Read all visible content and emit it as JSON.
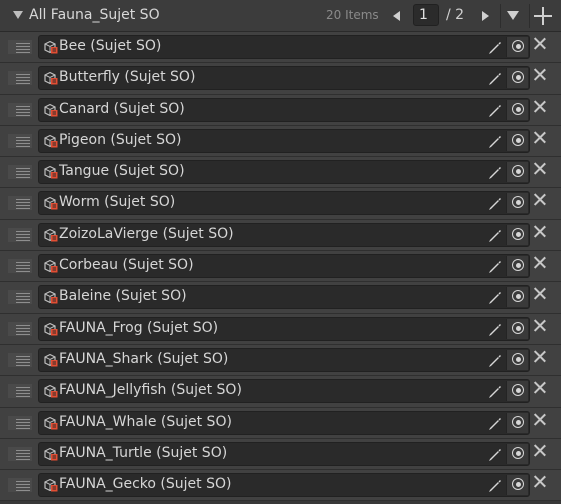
{
  "header": {
    "title": "All Fauna_Sujet SO",
    "count": "20 Items",
    "page": "1",
    "total": "/ 2"
  },
  "items": [
    {
      "label": "Bee (Sujet SO)"
    },
    {
      "label": "Butterfly (Sujet SO)"
    },
    {
      "label": "Canard (Sujet SO)"
    },
    {
      "label": "Pigeon (Sujet SO)"
    },
    {
      "label": "Tangue (Sujet SO)"
    },
    {
      "label": "Worm (Sujet SO)"
    },
    {
      "label": "ZoizoLaVierge (Sujet SO)"
    },
    {
      "label": "Corbeau (Sujet SO)"
    },
    {
      "label": "Baleine (Sujet SO)"
    },
    {
      "label": "FAUNA_Frog (Sujet SO)"
    },
    {
      "label": "FAUNA_Shark (Sujet SO)"
    },
    {
      "label": "FAUNA_Jellyfish (Sujet SO)"
    },
    {
      "label": "FAUNA_Whale (Sujet SO)"
    },
    {
      "label": "FAUNA_Turtle (Sujet SO)"
    },
    {
      "label": "FAUNA_Gecko (Sujet SO)"
    }
  ],
  "icons": {
    "foldout": "triangle-down-icon",
    "prev": "chevron-left-icon",
    "next": "chevron-right-icon",
    "menu": "dropdown-icon",
    "add": "plus-icon",
    "handle": "drag-handle-icon",
    "asset": "scriptable-object-icon",
    "edit": "pencil-icon",
    "pick": "object-picker-icon",
    "remove": "close-icon"
  },
  "colors": {
    "accent": "#e24d33",
    "panel": "#383838",
    "field": "#2a2a2a",
    "text": "#d6d6d6"
  }
}
